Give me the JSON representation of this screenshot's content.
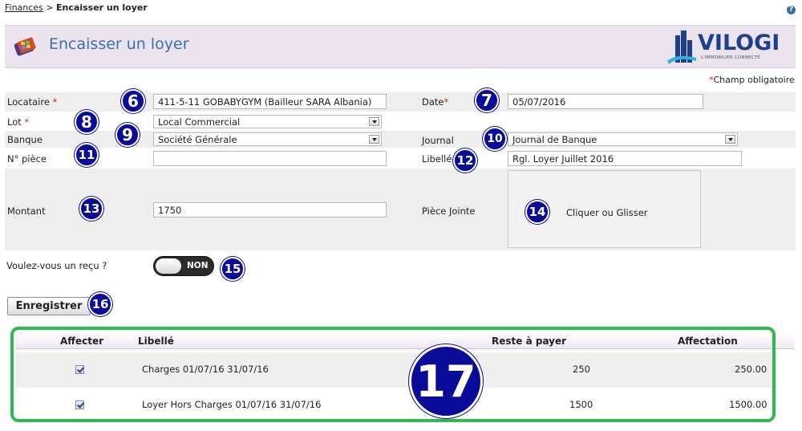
{
  "breadcrumb": {
    "parent": "Finances",
    "separator": " > ",
    "current": "Encaisser un loyer"
  },
  "header": {
    "title": "Encaisser un loyer",
    "logo_text": "VILOGI",
    "logo_tagline": "L'IMMOBILIER CONNECTÉ"
  },
  "required_note": {
    "star": "*",
    "text": "Champ obligatoire"
  },
  "form": {
    "locataire": {
      "label": "Locataire",
      "star": "*",
      "value": "411-5-11 GOBABYGYM  (Bailleur SARA Albania)"
    },
    "date": {
      "label": "Date",
      "star": "*",
      "value": "05/07/2016"
    },
    "lot": {
      "label": "Lot",
      "star": "*",
      "value": "Local Commercial"
    },
    "banque": {
      "label": "Banque",
      "value": "Société Générale"
    },
    "journal": {
      "label": "Journal",
      "value": "Journal de Banque"
    },
    "piece": {
      "label": "N° pièce",
      "value": ""
    },
    "libelle": {
      "label": "Libellé",
      "value": "Rgl. Loyer Juillet 2016"
    },
    "montant": {
      "label": "Montant",
      "value": "1750"
    },
    "piece_jointe": {
      "label": "Pièce Jointe",
      "drop_text": "Cliquer ou Glisser"
    },
    "recu": {
      "label": "Voulez-vous un reçu ?",
      "toggle_text": "NON",
      "enabled": false
    }
  },
  "save_button": "Enregistrer",
  "table": {
    "headers": {
      "affecter": "Affecter",
      "libelle": "Libellé",
      "reste": "Reste à payer",
      "affectation": "Affectation"
    },
    "rows": [
      {
        "checked": true,
        "libelle": "Charges 01/07/16 31/07/16",
        "reste": "250",
        "affectation": "250.00"
      },
      {
        "checked": true,
        "libelle": "Loyer Hors Charges 01/07/16 31/07/16",
        "reste": "1500",
        "affectation": "1500.00"
      }
    ]
  },
  "badges": [
    "6",
    "7",
    "8",
    "9",
    "10",
    "11",
    "12",
    "13",
    "14",
    "15",
    "16",
    "17"
  ],
  "colors": {
    "accent_title": "#3a6fb0",
    "badge": "#0b0b9a",
    "table_frame": "#2fba4f",
    "required": "#d21f1f",
    "header_bg": "#ebe4ef"
  }
}
